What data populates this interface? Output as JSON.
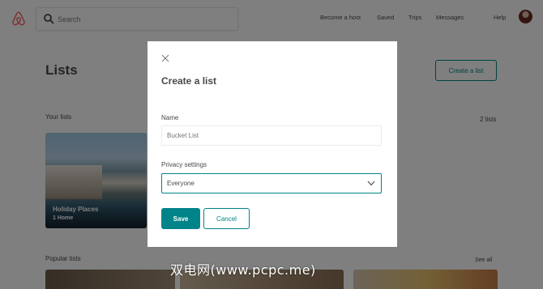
{
  "header": {
    "search": {
      "placeholder": "Search"
    },
    "nav": [
      "Become a host",
      "Saved",
      "Trips",
      "Messages",
      "Help"
    ]
  },
  "page": {
    "title": "Lists",
    "create_button": "Create a list",
    "your_lists": {
      "label": "Your lists",
      "count": "2 lists"
    },
    "cards": [
      {
        "title": "Holiday Places",
        "subtitle": "1 Home"
      }
    ],
    "popular": {
      "label": "Popular lists",
      "see_all": "See all"
    }
  },
  "modal": {
    "title": "Create a list",
    "name_label": "Name",
    "name_placeholder": "Bucket List",
    "privacy_label": "Privacy settings",
    "privacy_value": "Everyone",
    "save_label": "Save",
    "cancel_label": "Cancel"
  },
  "watermark": "双电网(www.pcpc.me)",
  "colors": {
    "brand": "#ff5a5f",
    "accent": "#008489",
    "text": "#484848",
    "overlay": "rgba(0,0,0,0.5)"
  },
  "icons": [
    "airbnb-logo-icon",
    "search-icon",
    "close-icon",
    "chevron-down-icon"
  ]
}
